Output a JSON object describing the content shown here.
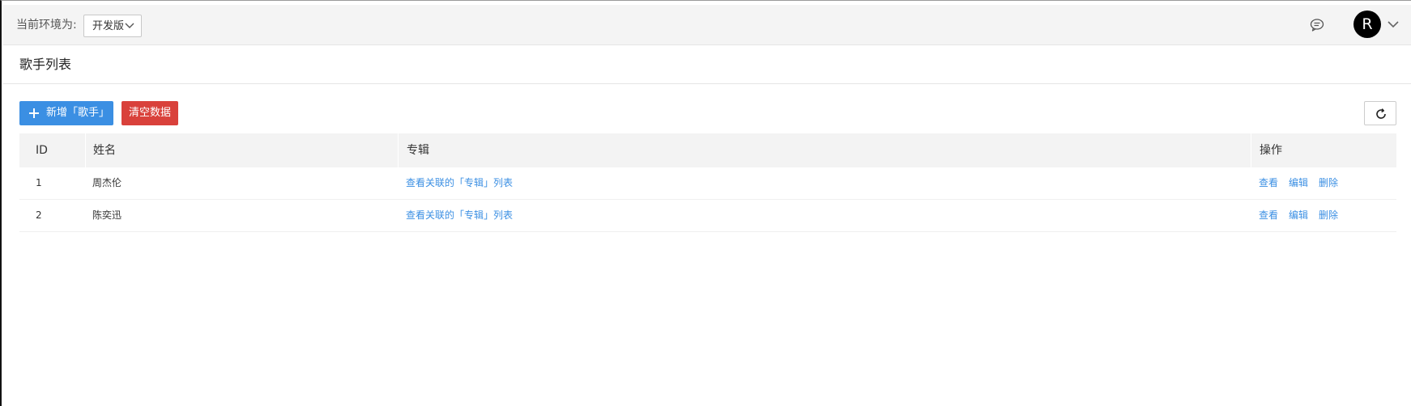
{
  "topbar": {
    "env_label": "当前环境为:",
    "env_select_value": "开发版",
    "avatar_letter": "R"
  },
  "page": {
    "title": "歌手列表"
  },
  "toolbar": {
    "add_label": "新增「歌手」",
    "clear_label": "清空数据"
  },
  "colors": {
    "primary": "#3b8fe3",
    "danger": "#d9413b",
    "topbar_bg": "#f4f4f4",
    "table_header_bg": "#f3f3f3"
  },
  "icons": {
    "add": "plus-icon",
    "refresh": "refresh-icon",
    "comment": "comment-icon",
    "dropdown": "chevron-down-icon"
  },
  "table": {
    "columns": [
      "ID",
      "姓名",
      "专辑",
      "操作"
    ],
    "rows": [
      {
        "id": "1",
        "name": "周杰伦",
        "album_link": "查看关联的「专辑」列表",
        "actions": [
          "查看",
          "编辑",
          "删除"
        ]
      },
      {
        "id": "2",
        "name": "陈奕迅",
        "album_link": "查看关联的「专辑」列表",
        "actions": [
          "查看",
          "编辑",
          "删除"
        ]
      }
    ]
  }
}
